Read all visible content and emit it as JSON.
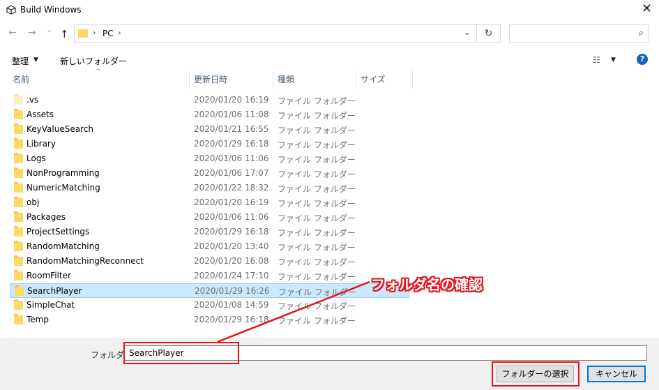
{
  "window": {
    "title": "Build Windows",
    "close_glyph": "✕",
    "icon": "unity-logo-icon"
  },
  "nav": {
    "back_icon": "←",
    "forward_icon": "→",
    "recent_icon": "⌄",
    "up_icon": "↑",
    "address": {
      "separator": "›",
      "location": "PC",
      "dropdown_icon": "⌄"
    },
    "refresh_icon": "↻",
    "search": {
      "value": "",
      "icon": "⌕"
    }
  },
  "toolbar": {
    "organize_label": "整理",
    "organize_arrow": "▼",
    "new_folder_label": "新しいフォルダー",
    "view_icon": "☷",
    "view_arrow": "▼",
    "help_icon": "?"
  },
  "columns": {
    "name": "名前",
    "date": "更新日時",
    "type": "種類",
    "size": "サイズ",
    "sort_indicator": "^"
  },
  "files": [
    {
      "name": ".vs",
      "date": "2020/01/20 16:19",
      "type": "ファイル フォルダー",
      "faded": true
    },
    {
      "name": "Assets",
      "date": "2020/01/06 11:08",
      "type": "ファイル フォルダー"
    },
    {
      "name": "KeyValueSearch",
      "date": "2020/01/21 16:55",
      "type": "ファイル フォルダー"
    },
    {
      "name": "Library",
      "date": "2020/01/29 16:18",
      "type": "ファイル フォルダー"
    },
    {
      "name": "Logs",
      "date": "2020/01/06 11:06",
      "type": "ファイル フォルダー"
    },
    {
      "name": "NonProgramming",
      "date": "2020/01/06 17:07",
      "type": "ファイル フォルダー"
    },
    {
      "name": "NumericMatching",
      "date": "2020/01/22 18:32",
      "type": "ファイル フォルダー"
    },
    {
      "name": "obj",
      "date": "2020/01/20 16:19",
      "type": "ファイル フォルダー"
    },
    {
      "name": "Packages",
      "date": "2020/01/06 11:06",
      "type": "ファイル フォルダー"
    },
    {
      "name": "ProjectSettings",
      "date": "2020/01/29 16:18",
      "type": "ファイル フォルダー"
    },
    {
      "name": "RandomMatching",
      "date": "2020/01/20 13:40",
      "type": "ファイル フォルダー"
    },
    {
      "name": "RandomMatchingReconnect",
      "date": "2020/01/20 16:08",
      "type": "ファイル フォルダー"
    },
    {
      "name": "RoomFilter",
      "date": "2020/01/24 17:10",
      "type": "ファイル フォルダー"
    },
    {
      "name": "SearchPlayer",
      "date": "2020/01/29 16:26",
      "type": "ファイル フォルダー",
      "selected": true
    },
    {
      "name": "SimpleChat",
      "date": "2020/01/08 14:59",
      "type": "ファイル フォルダー"
    },
    {
      "name": "Temp",
      "date": "2020/01/29 16:18",
      "type": "ファイル フォルダー"
    }
  ],
  "footer": {
    "folder_label": "フォルダー:",
    "folder_value": "SearchPlayer",
    "select_button": "フォルダーの選択",
    "cancel_button": "キャンセル"
  },
  "annotation": {
    "text": "フォルダ名の確認",
    "color": "#e8141a"
  }
}
